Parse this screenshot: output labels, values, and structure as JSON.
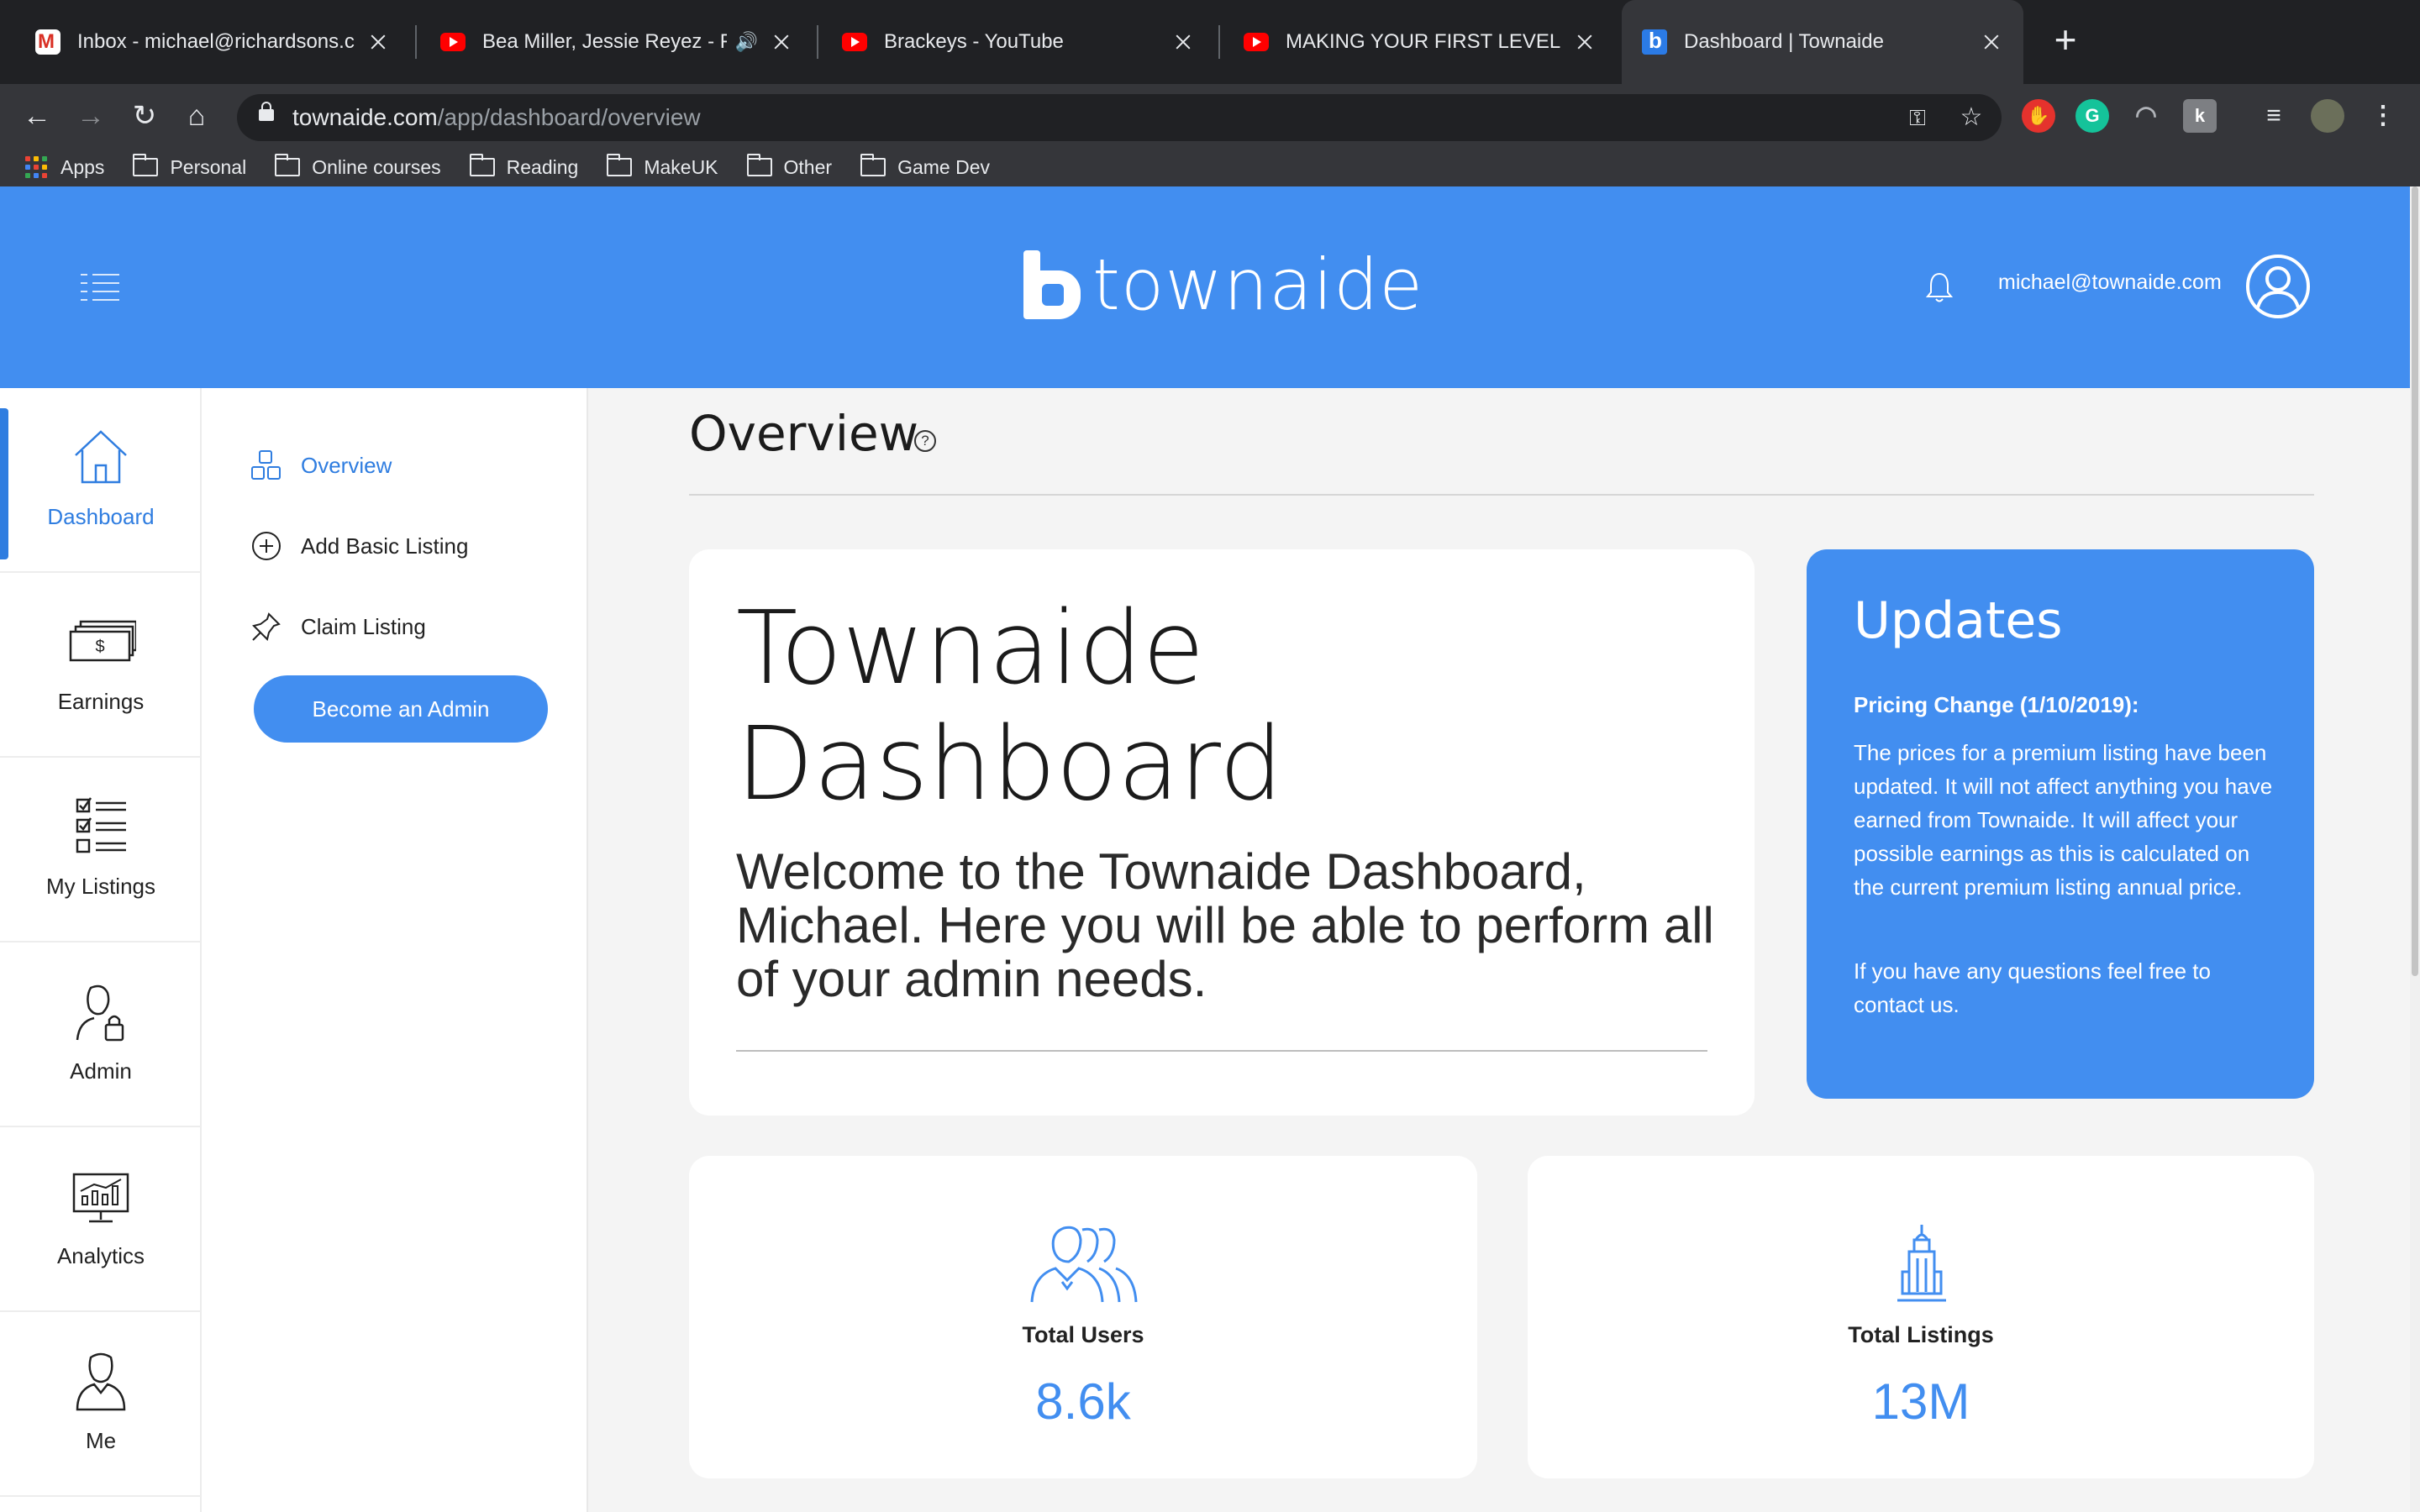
{
  "browser": {
    "tabs": [
      {
        "title": "Inbox - michael@richardsons.co",
        "favicon": "gmail-icon"
      },
      {
        "title": "Bea Miller, Jessie Reyez - FE",
        "favicon": "youtube-icon",
        "audio": "🔊"
      },
      {
        "title": "Brackeys - YouTube",
        "favicon": "youtube-icon"
      },
      {
        "title": "MAKING YOUR FIRST LEVEL in U",
        "favicon": "youtube-icon"
      },
      {
        "title": "Dashboard | Townaide",
        "favicon": "townaide-icon",
        "active": true
      }
    ],
    "new_tab": "+",
    "url_host": "townaide.com",
    "url_path": "/app/dashboard/overview",
    "bookmarks": [
      "Apps",
      "Personal",
      "Online courses",
      "Reading",
      "MakeUK",
      "Other",
      "Game Dev"
    ]
  },
  "header": {
    "logo_text": "townaide",
    "user_email": "michael@townaide.com"
  },
  "leftnav": [
    {
      "label": "Dashboard",
      "icon": "house-icon",
      "active": true
    },
    {
      "label": "Earnings",
      "icon": "money-icon"
    },
    {
      "label": "My Listings",
      "icon": "checklist-icon"
    },
    {
      "label": "Admin",
      "icon": "admin-user-lock-icon"
    },
    {
      "label": "Analytics",
      "icon": "analytics-monitor-icon"
    },
    {
      "label": "Me",
      "icon": "profile-icon"
    }
  ],
  "subnav": {
    "items": [
      {
        "label": "Overview",
        "icon": "overview-blocks-icon",
        "active": true
      },
      {
        "label": "Add Basic Listing",
        "icon": "plus-circle-icon"
      },
      {
        "label": "Claim Listing",
        "icon": "pin-icon"
      }
    ],
    "admin_button": "Become an Admin"
  },
  "main": {
    "page_title": "Overview",
    "help_icon": "?",
    "welcome": {
      "title_line1": "Townaide",
      "title_line2": "Dashboard",
      "text": "Welcome to the Townaide Dashboard, Michael. Here you will be able to perform all of your admin needs."
    },
    "updates": {
      "title": "Updates",
      "subhead": "Pricing Change (1/10/2019):",
      "body1": "The prices for a premium listing have been updated. It will not affect anything you have earned from Townaide. It will affect your possible earnings as this is calculated on the current premium listing annual price.",
      "body2": "If you have any questions feel free to contact us."
    },
    "stats": [
      {
        "label": "Total Users",
        "value": "8.6k",
        "icon": "users-icon"
      },
      {
        "label": "Total Listings",
        "value": "13M",
        "icon": "building-icon"
      }
    ]
  },
  "colors": {
    "brand_blue": "#428ef0",
    "active_blue": "#2f7de0",
    "chrome_dark": "#202124"
  }
}
